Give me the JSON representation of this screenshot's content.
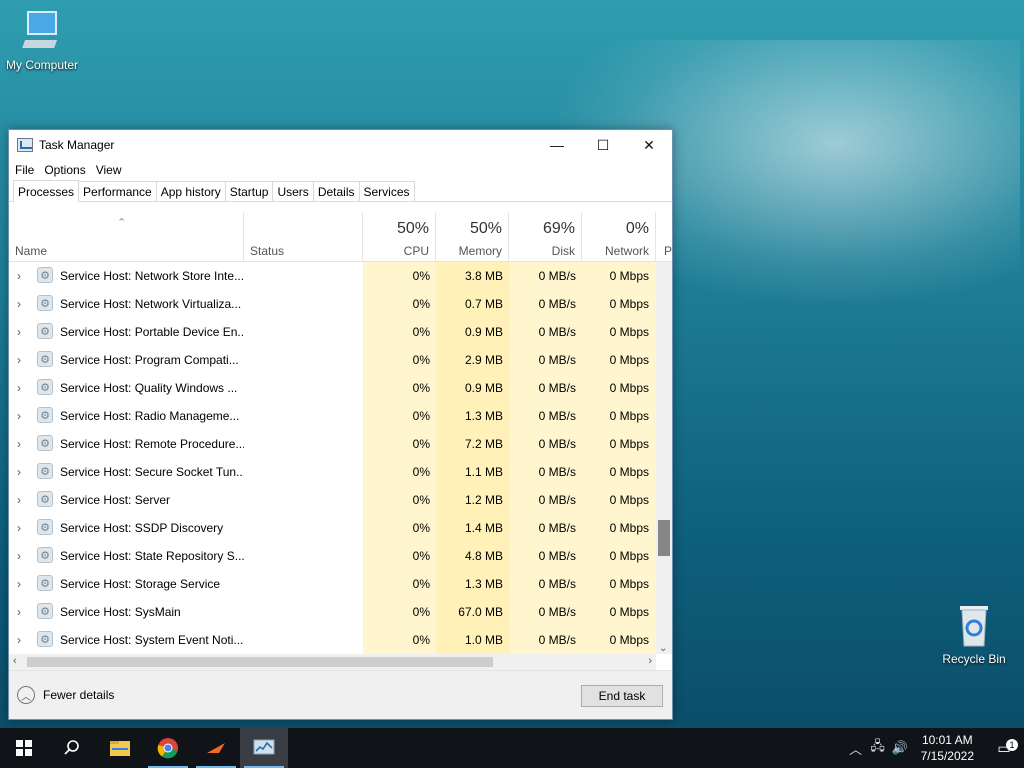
{
  "desktop": {
    "my_computer": "My Computer",
    "recycle_bin": "Recycle Bin"
  },
  "window": {
    "title": "Task Manager",
    "minimize": "—",
    "maximize": "☐",
    "close": "✕"
  },
  "menu": [
    "File",
    "Options",
    "View"
  ],
  "tabs": [
    "Processes",
    "Performance",
    "App history",
    "Startup",
    "Users",
    "Details",
    "Services"
  ],
  "active_tab": "Processes",
  "columns": {
    "name": "Name",
    "status": "Status",
    "cpu": {
      "pct": "50%",
      "label": "CPU"
    },
    "memory": {
      "pct": "50%",
      "label": "Memory"
    },
    "disk": {
      "pct": "69%",
      "label": "Disk"
    },
    "network": {
      "pct": "0%",
      "label": "Network"
    },
    "power_partial": "P"
  },
  "rows": [
    {
      "name": "Service Host: Network Store Inte...",
      "cpu": "0%",
      "memory": "3.8 MB",
      "disk": "0 MB/s",
      "network": "0 Mbps"
    },
    {
      "name": "Service Host: Network Virtualiza...",
      "cpu": "0%",
      "memory": "0.7 MB",
      "disk": "0 MB/s",
      "network": "0 Mbps"
    },
    {
      "name": "Service Host: Portable Device En...",
      "cpu": "0%",
      "memory": "0.9 MB",
      "disk": "0 MB/s",
      "network": "0 Mbps"
    },
    {
      "name": "Service Host: Program Compati...",
      "cpu": "0%",
      "memory": "2.9 MB",
      "disk": "0 MB/s",
      "network": "0 Mbps"
    },
    {
      "name": "Service Host: Quality Windows ...",
      "cpu": "0%",
      "memory": "0.9 MB",
      "disk": "0 MB/s",
      "network": "0 Mbps"
    },
    {
      "name": "Service Host: Radio Manageme...",
      "cpu": "0%",
      "memory": "1.3 MB",
      "disk": "0 MB/s",
      "network": "0 Mbps"
    },
    {
      "name": "Service Host: Remote Procedure...",
      "cpu": "0%",
      "memory": "7.2 MB",
      "disk": "0 MB/s",
      "network": "0 Mbps"
    },
    {
      "name": "Service Host: Secure Socket Tun...",
      "cpu": "0%",
      "memory": "1.1 MB",
      "disk": "0 MB/s",
      "network": "0 Mbps"
    },
    {
      "name": "Service Host: Server",
      "cpu": "0%",
      "memory": "1.2 MB",
      "disk": "0 MB/s",
      "network": "0 Mbps"
    },
    {
      "name": "Service Host: SSDP Discovery",
      "cpu": "0%",
      "memory": "1.4 MB",
      "disk": "0 MB/s",
      "network": "0 Mbps"
    },
    {
      "name": "Service Host: State Repository S...",
      "cpu": "0%",
      "memory": "4.8 MB",
      "disk": "0 MB/s",
      "network": "0 Mbps"
    },
    {
      "name": "Service Host: Storage Service",
      "cpu": "0%",
      "memory": "1.3 MB",
      "disk": "0 MB/s",
      "network": "0 Mbps"
    },
    {
      "name": "Service Host: SysMain",
      "cpu": "0%",
      "memory": "67.0 MB",
      "disk": "0 MB/s",
      "network": "0 Mbps"
    },
    {
      "name": "Service Host: System Event Noti...",
      "cpu": "0%",
      "memory": "1.0 MB",
      "disk": "0 MB/s",
      "network": "0 Mbps"
    }
  ],
  "footer": {
    "fewer_details": "Fewer details",
    "end_task": "End task"
  },
  "taskbar": {
    "clock_time": "10:01 AM",
    "clock_date": "7/15/2022",
    "notification_count": "1"
  },
  "colors": {
    "highlight_column": "#fff4c4",
    "taskbar": "#101318",
    "taskbar_accent": "#76b9ed"
  }
}
